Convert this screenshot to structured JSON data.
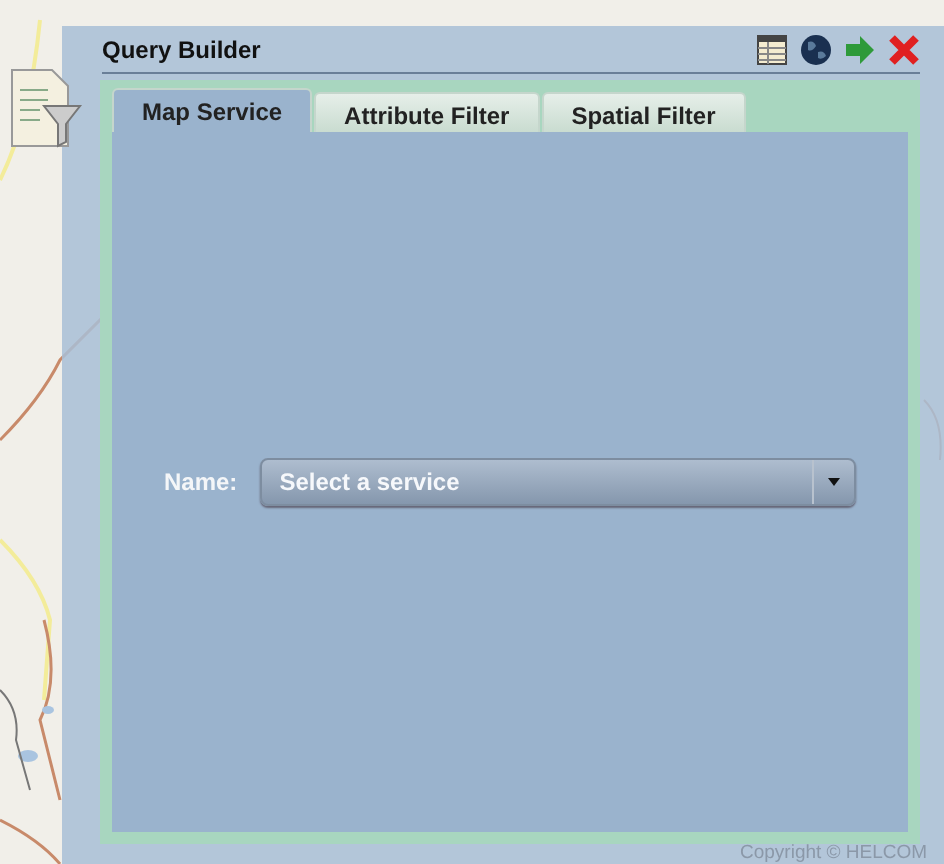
{
  "window": {
    "title": "Query Builder"
  },
  "tabs": [
    {
      "label": "Map Service",
      "selected": true
    },
    {
      "label": "Attribute Filter",
      "selected": false
    },
    {
      "label": "Spatial Filter",
      "selected": false
    }
  ],
  "form": {
    "label": "Name:",
    "select": {
      "placeholder": "Select a service"
    }
  },
  "copyright": "Copyright © HELCOM"
}
